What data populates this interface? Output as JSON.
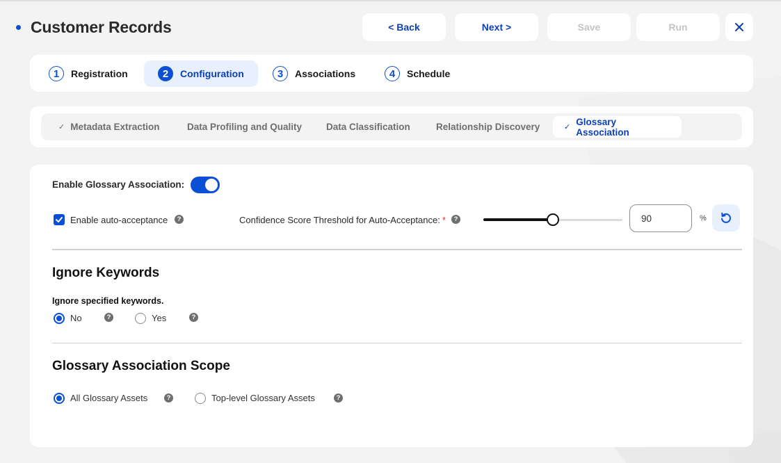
{
  "header": {
    "title": "Customer Records",
    "buttons": {
      "back": "< Back",
      "next": "Next >",
      "save": "Save",
      "run": "Run"
    }
  },
  "steps": [
    {
      "num": "1",
      "label": "Registration",
      "active": false
    },
    {
      "num": "2",
      "label": "Configuration",
      "active": true
    },
    {
      "num": "3",
      "label": "Associations",
      "active": false
    },
    {
      "num": "4",
      "label": "Schedule",
      "active": false
    }
  ],
  "substeps": [
    {
      "label": "Metadata Extraction",
      "check": "✓",
      "completed": true,
      "active": false
    },
    {
      "label": "Data Profiling and Quality",
      "check": "",
      "completed": false,
      "active": false
    },
    {
      "label": "Data Classification",
      "check": "",
      "completed": false,
      "active": false
    },
    {
      "label": "Relationship Discovery",
      "check": "",
      "completed": false,
      "active": false
    },
    {
      "label": "Glossary Association",
      "check": "✓",
      "completed": true,
      "active": true
    }
  ],
  "glossary": {
    "enable_label": "Enable Glossary Association:",
    "enabled": true,
    "auto_accept_label": "Enable auto-acceptance",
    "auto_accept_checked": true,
    "threshold_label": "Confidence Score Threshold for Auto-Acceptance:",
    "threshold_required_mark": "*",
    "threshold_value": "90",
    "threshold_unit": "%",
    "slider_fill_fraction": 0.5
  },
  "ignore_keywords": {
    "title": "Ignore Keywords",
    "question": "Ignore specified keywords.",
    "options": [
      {
        "label": "No",
        "checked": true
      },
      {
        "label": "Yes",
        "checked": false
      }
    ]
  },
  "scope": {
    "title": "Glossary Association Scope",
    "options": [
      {
        "label": "All Glossary Assets",
        "checked": true
      },
      {
        "label": "Top-level Glossary Assets",
        "checked": false
      }
    ]
  },
  "icons": {
    "help": "?",
    "close": "close-icon",
    "reset": "reset-icon"
  },
  "colors": {
    "accent": "#0b4fd6",
    "accent_text": "#0b3fb8",
    "active_bg": "#e9f0fd",
    "disabled_text": "#c4c4c4",
    "required": "#d93025"
  }
}
